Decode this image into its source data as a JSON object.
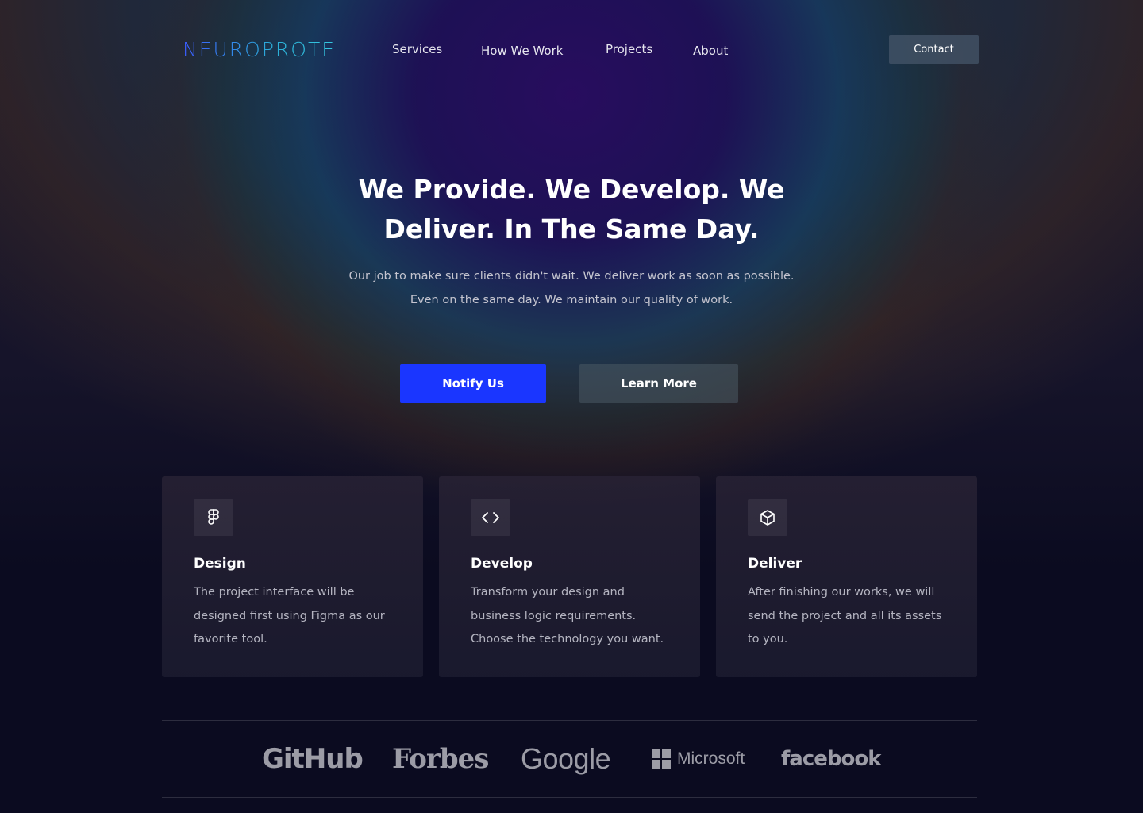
{
  "nav": {
    "logo": "NEUROPROTE",
    "links": [
      "Services",
      "How We Work",
      "Projects",
      "About"
    ],
    "contact_label": "Contact"
  },
  "hero": {
    "title": "We Provide. We Develop. We Deliver. In The Same Day.",
    "text": "Our job to make sure clients didn't wait. We deliver work as soon as possible. Even on the same day. We maintain our quality of work.",
    "primary_label": "Notify Us",
    "secondary_label": "Learn More"
  },
  "cards": [
    {
      "icon": "figma-icon",
      "title": "Design",
      "text": "The project interface will be designed first using Figma as our favorite tool."
    },
    {
      "icon": "code-icon",
      "title": "Develop",
      "text": "Transform your design and business logic requirements. Choose the technology you want."
    },
    {
      "icon": "box-icon",
      "title": "Deliver",
      "text": "After finishing our works, we will send the project and all its assets to you."
    }
  ],
  "brands": [
    "GitHub",
    "Forbes",
    "Google",
    "Microsoft",
    "facebook"
  ],
  "colors": {
    "primary_button": "#1a36ff",
    "background": "#0b0b20",
    "logo_gradient_start": "#3b5bff",
    "logo_gradient_end": "#36c8e0"
  }
}
